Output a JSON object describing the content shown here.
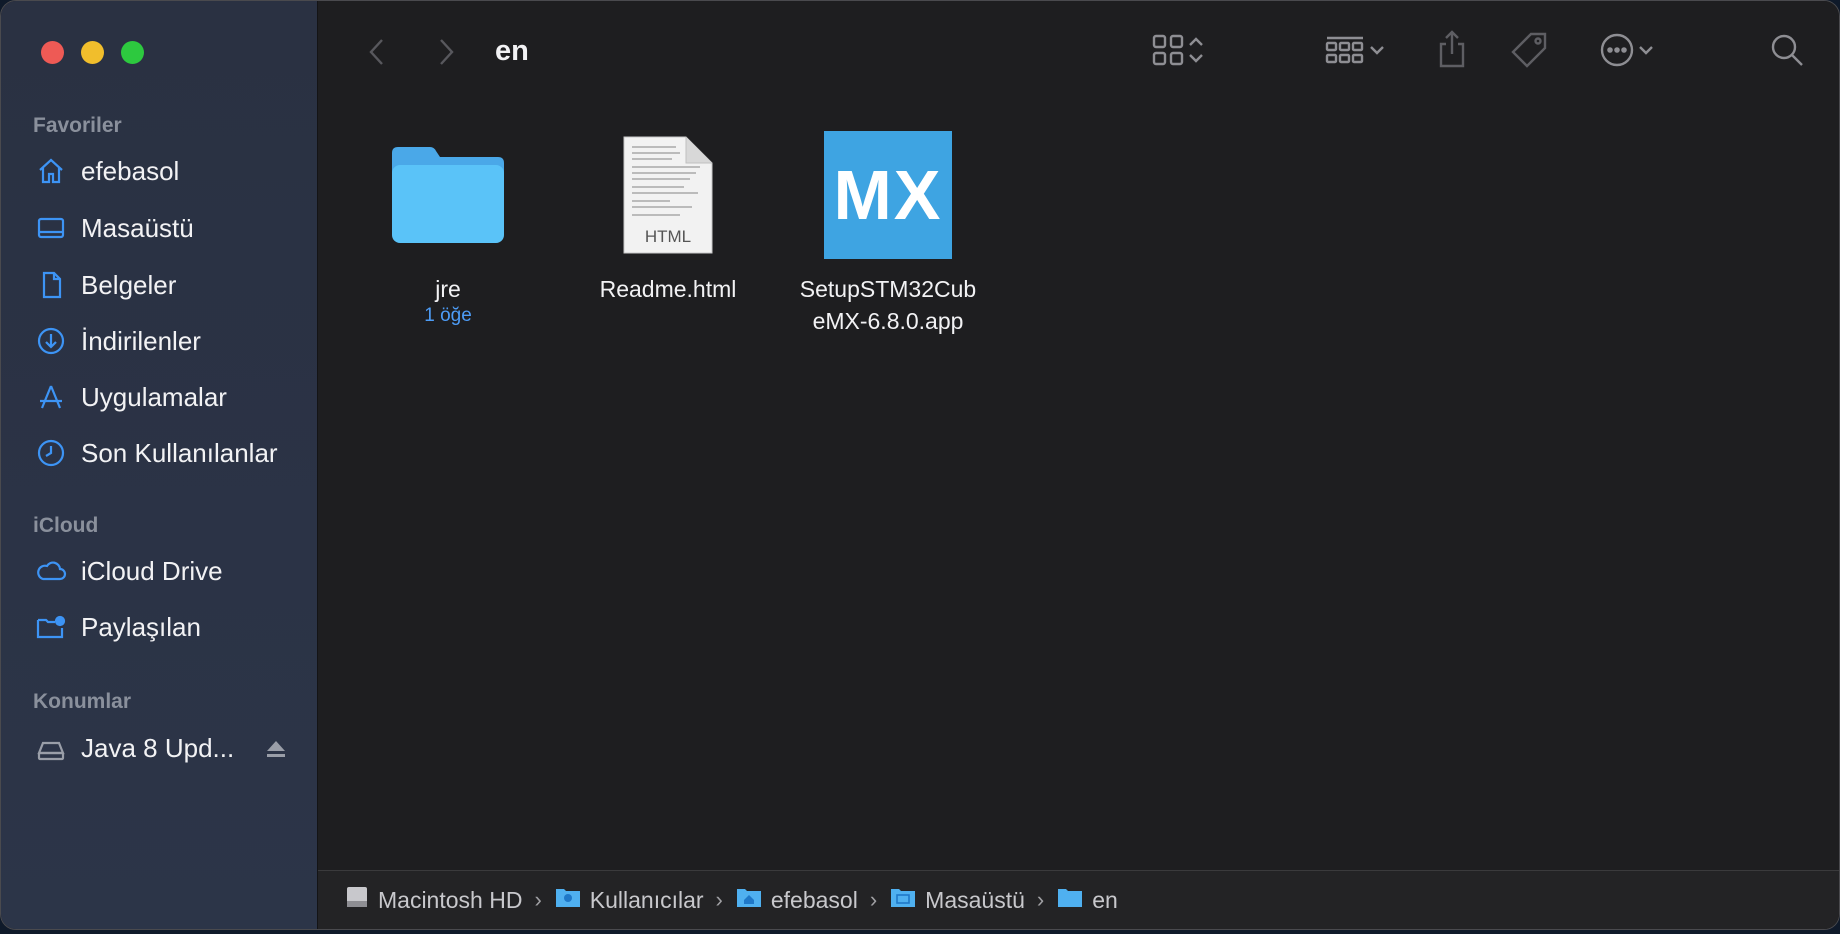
{
  "window": {
    "title": "en"
  },
  "sidebar": {
    "sections": [
      {
        "title": "Favoriler"
      },
      {
        "title": "iCloud"
      },
      {
        "title": "Konumlar"
      }
    ],
    "favorites": [
      {
        "label": "efebasol",
        "icon": "home-icon"
      },
      {
        "label": "Masaüstü",
        "icon": "desktop-icon"
      },
      {
        "label": "Belgeler",
        "icon": "document-icon"
      },
      {
        "label": "İndirilenler",
        "icon": "download-icon"
      },
      {
        "label": "Uygulamalar",
        "icon": "applications-icon"
      },
      {
        "label": "Son Kullanılanlar",
        "icon": "clock-icon"
      }
    ],
    "icloud": [
      {
        "label": "iCloud Drive",
        "icon": "cloud-icon"
      },
      {
        "label": "Paylaşılan",
        "icon": "shared-folder-icon"
      }
    ],
    "locations": [
      {
        "label": "Java 8 Upd...",
        "icon": "drive-icon"
      }
    ]
  },
  "files": [
    {
      "name": "jre",
      "subtitle": "1 öğe",
      "kind": "folder"
    },
    {
      "name": "Readme.html",
      "kind": "html-document",
      "badge": "HTML"
    },
    {
      "name_line1": "SetupSTM32Cub",
      "name_line2": "eMX-6.8.0.app",
      "kind": "application",
      "badge": "MX"
    }
  ],
  "pathbar": {
    "crumbs": [
      "Macintosh HD",
      "Kullanıcılar",
      "efebasol",
      "Masaüstü",
      "en"
    ]
  },
  "colors": {
    "accent": "#3d94f5",
    "folder": "#5ac3f8",
    "mx_tile": "#3ea4e2"
  }
}
